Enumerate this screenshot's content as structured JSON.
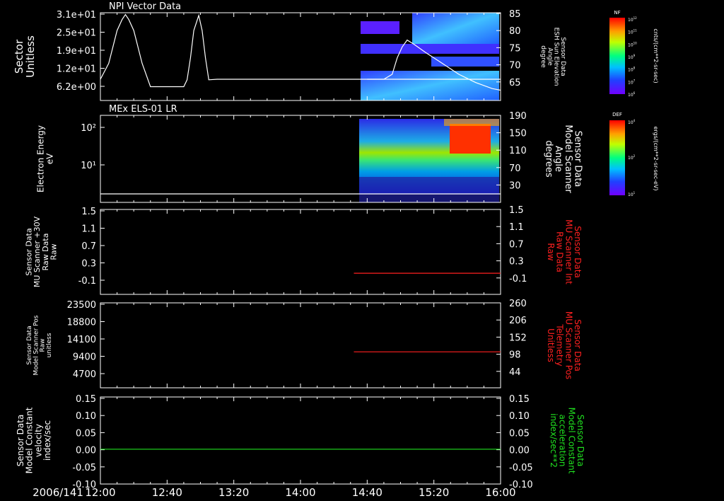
{
  "time_axis": {
    "date": "2006/141",
    "ticks": [
      "12:00",
      "12:40",
      "13:20",
      "14:00",
      "14:40",
      "15:20",
      "16:00"
    ],
    "start_min": 720,
    "end_min": 960
  },
  "colorbars": [
    {
      "tag": "NF",
      "unit": "cnts/(cm**2-sr-sec)",
      "exponents": [
        "12",
        "11",
        "10",
        "9",
        "8",
        "7",
        "6"
      ]
    },
    {
      "tag": "DEF",
      "unit": "ergs/(cm**2-sr-sec-eV)",
      "exponents": [
        "4",
        "2",
        "1"
      ]
    }
  ],
  "chart_data": [
    {
      "type": "line",
      "title": "NPI Vector Data",
      "ylabel": [
        "Sector",
        "Unitless"
      ],
      "yticks": [
        "3.1e+01",
        "2.5e+01",
        "1.9e+01",
        "1.2e+01",
        "6.2e+00"
      ],
      "ylim": [
        0,
        31
      ],
      "right_ticks": [
        "85",
        "80",
        "75",
        "70",
        "65"
      ],
      "right_label": [
        "Sensor Data",
        "ESH Sun Elevation",
        "Angle",
        "degree"
      ],
      "right_label_color": "#ffffff",
      "series": [
        {
          "color": "#ffffff",
          "x": [
            720,
            725,
            730,
            733,
            735,
            737,
            740,
            745,
            750,
            770,
            772,
            774,
            776,
            779,
            781,
            783,
            785,
            790,
            960
          ],
          "y": [
            6.2,
            12,
            24,
            28,
            29.8,
            28,
            24,
            12,
            3.5,
            3.5,
            6,
            14,
            24,
            29.5,
            24,
            14,
            6,
            6.2,
            6.2
          ]
        },
        {
          "color": "#ffffff",
          "x": [
            880,
            890,
            895,
            898,
            901,
            904,
            908,
            915,
            925,
            935,
            945,
            955,
            960
          ],
          "y": [
            6.2,
            6.2,
            8,
            14,
            18,
            20.5,
            19,
            16,
            12,
            8,
            5,
            2.8,
            2.2
          ]
        }
      ]
    },
    {
      "type": "heatmap",
      "title": "MEx ELS-01 LR",
      "ylabel": [
        "Electron Energy",
        "eV"
      ],
      "yticks": [
        "10²",
        "10¹"
      ],
      "right_ticks": [
        "190",
        "150",
        "110",
        "70",
        "30"
      ],
      "right_label": [
        "Sensor Data",
        "Model Scanner",
        "Angle",
        "degrees"
      ],
      "right_label_color": "#ffffff",
      "series": [
        {
          "color": "#ffffff",
          "x": [
            720,
            960
          ],
          "y": [
            1.6,
            1.6
          ]
        }
      ]
    },
    {
      "type": "line",
      "ylabel": [
        "Sensor Data",
        "MU Scanner +30V",
        "Raw Data",
        "Raw"
      ],
      "yticks": [
        "1.5",
        "1.1",
        "0.7",
        "0.3",
        "-0.1"
      ],
      "ylim": [
        -0.1,
        1.5
      ],
      "right_ticks": [
        "1.5",
        "1.1",
        "0.7",
        "0.3",
        "-0.1"
      ],
      "right_label": [
        "Sensor Data",
        "MU Scanner Int",
        "Raw Data",
        "Raw"
      ],
      "right_label_color": "#ff2020",
      "series": [
        {
          "color": "#ff2020",
          "x": [
            872,
            960
          ],
          "y": [
            0.0,
            0.0
          ]
        }
      ]
    },
    {
      "type": "line",
      "ylabel": [
        "Sensor Data",
        "Model Scanner Pos",
        "Raw",
        "unitless"
      ],
      "yticks": [
        "23500",
        "18800",
        "14100",
        "9400",
        "4700"
      ],
      "ylim": [
        0,
        23500
      ],
      "right_ticks": [
        "260",
        "206",
        "152",
        "98",
        "44"
      ],
      "right_label": [
        "Sensor Data",
        "MU Scanner Pos",
        "Telemetry",
        "Unitless"
      ],
      "right_label_color": "#ff2020",
      "series": [
        {
          "color": "#ff2020",
          "x": [
            872,
            960
          ],
          "y": [
            7300,
            7300
          ]
        }
      ]
    },
    {
      "type": "line",
      "ylabel": [
        "Sensor Data",
        "Model Constant",
        "velocity",
        "index/sec"
      ],
      "yticks": [
        "0.15",
        "0.10",
        "0.05",
        "0.00",
        "-0.05",
        "-0.10"
      ],
      "ylim": [
        -0.1,
        0.15
      ],
      "right_ticks": [
        "0.15",
        "0.10",
        "0.05",
        "0.00",
        "-0.05",
        "-0.10"
      ],
      "right_label": [
        "Sensor Data",
        "Model Constant",
        "acceleration",
        "index/sec**2"
      ],
      "right_label_color": "#20e020",
      "series": [
        {
          "color": "#20e020",
          "x": [
            720,
            960
          ],
          "y": [
            0.0,
            0.0
          ]
        }
      ]
    }
  ]
}
